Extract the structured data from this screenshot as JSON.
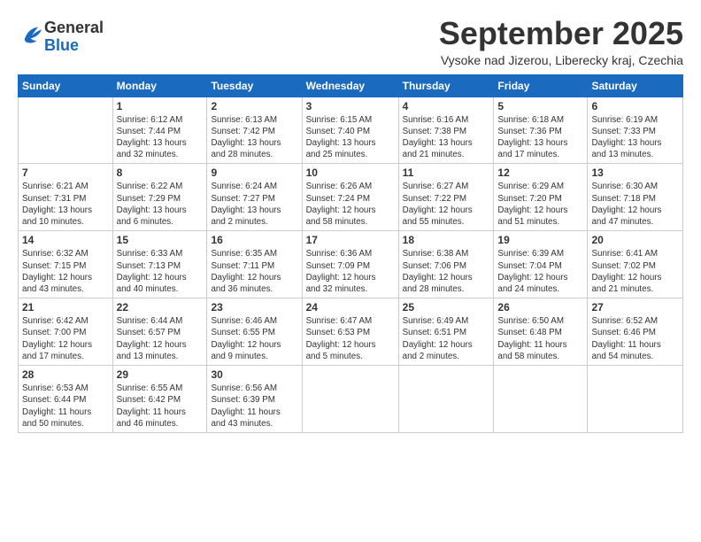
{
  "logo": {
    "general": "General",
    "blue": "Blue"
  },
  "title": "September 2025",
  "location": "Vysoke nad Jizerou, Liberecky kraj, Czechia",
  "days_header": [
    "Sunday",
    "Monday",
    "Tuesday",
    "Wednesday",
    "Thursday",
    "Friday",
    "Saturday"
  ],
  "weeks": [
    [
      {
        "day": "",
        "info": ""
      },
      {
        "day": "1",
        "info": "Sunrise: 6:12 AM\nSunset: 7:44 PM\nDaylight: 13 hours\nand 32 minutes."
      },
      {
        "day": "2",
        "info": "Sunrise: 6:13 AM\nSunset: 7:42 PM\nDaylight: 13 hours\nand 28 minutes."
      },
      {
        "day": "3",
        "info": "Sunrise: 6:15 AM\nSunset: 7:40 PM\nDaylight: 13 hours\nand 25 minutes."
      },
      {
        "day": "4",
        "info": "Sunrise: 6:16 AM\nSunset: 7:38 PM\nDaylight: 13 hours\nand 21 minutes."
      },
      {
        "day": "5",
        "info": "Sunrise: 6:18 AM\nSunset: 7:36 PM\nDaylight: 13 hours\nand 17 minutes."
      },
      {
        "day": "6",
        "info": "Sunrise: 6:19 AM\nSunset: 7:33 PM\nDaylight: 13 hours\nand 13 minutes."
      }
    ],
    [
      {
        "day": "7",
        "info": "Sunrise: 6:21 AM\nSunset: 7:31 PM\nDaylight: 13 hours\nand 10 minutes."
      },
      {
        "day": "8",
        "info": "Sunrise: 6:22 AM\nSunset: 7:29 PM\nDaylight: 13 hours\nand 6 minutes."
      },
      {
        "day": "9",
        "info": "Sunrise: 6:24 AM\nSunset: 7:27 PM\nDaylight: 13 hours\nand 2 minutes."
      },
      {
        "day": "10",
        "info": "Sunrise: 6:26 AM\nSunset: 7:24 PM\nDaylight: 12 hours\nand 58 minutes."
      },
      {
        "day": "11",
        "info": "Sunrise: 6:27 AM\nSunset: 7:22 PM\nDaylight: 12 hours\nand 55 minutes."
      },
      {
        "day": "12",
        "info": "Sunrise: 6:29 AM\nSunset: 7:20 PM\nDaylight: 12 hours\nand 51 minutes."
      },
      {
        "day": "13",
        "info": "Sunrise: 6:30 AM\nSunset: 7:18 PM\nDaylight: 12 hours\nand 47 minutes."
      }
    ],
    [
      {
        "day": "14",
        "info": "Sunrise: 6:32 AM\nSunset: 7:15 PM\nDaylight: 12 hours\nand 43 minutes."
      },
      {
        "day": "15",
        "info": "Sunrise: 6:33 AM\nSunset: 7:13 PM\nDaylight: 12 hours\nand 40 minutes."
      },
      {
        "day": "16",
        "info": "Sunrise: 6:35 AM\nSunset: 7:11 PM\nDaylight: 12 hours\nand 36 minutes."
      },
      {
        "day": "17",
        "info": "Sunrise: 6:36 AM\nSunset: 7:09 PM\nDaylight: 12 hours\nand 32 minutes."
      },
      {
        "day": "18",
        "info": "Sunrise: 6:38 AM\nSunset: 7:06 PM\nDaylight: 12 hours\nand 28 minutes."
      },
      {
        "day": "19",
        "info": "Sunrise: 6:39 AM\nSunset: 7:04 PM\nDaylight: 12 hours\nand 24 minutes."
      },
      {
        "day": "20",
        "info": "Sunrise: 6:41 AM\nSunset: 7:02 PM\nDaylight: 12 hours\nand 21 minutes."
      }
    ],
    [
      {
        "day": "21",
        "info": "Sunrise: 6:42 AM\nSunset: 7:00 PM\nDaylight: 12 hours\nand 17 minutes."
      },
      {
        "day": "22",
        "info": "Sunrise: 6:44 AM\nSunset: 6:57 PM\nDaylight: 12 hours\nand 13 minutes."
      },
      {
        "day": "23",
        "info": "Sunrise: 6:46 AM\nSunset: 6:55 PM\nDaylight: 12 hours\nand 9 minutes."
      },
      {
        "day": "24",
        "info": "Sunrise: 6:47 AM\nSunset: 6:53 PM\nDaylight: 12 hours\nand 5 minutes."
      },
      {
        "day": "25",
        "info": "Sunrise: 6:49 AM\nSunset: 6:51 PM\nDaylight: 12 hours\nand 2 minutes."
      },
      {
        "day": "26",
        "info": "Sunrise: 6:50 AM\nSunset: 6:48 PM\nDaylight: 11 hours\nand 58 minutes."
      },
      {
        "day": "27",
        "info": "Sunrise: 6:52 AM\nSunset: 6:46 PM\nDaylight: 11 hours\nand 54 minutes."
      }
    ],
    [
      {
        "day": "28",
        "info": "Sunrise: 6:53 AM\nSunset: 6:44 PM\nDaylight: 11 hours\nand 50 minutes."
      },
      {
        "day": "29",
        "info": "Sunrise: 6:55 AM\nSunset: 6:42 PM\nDaylight: 11 hours\nand 46 minutes."
      },
      {
        "day": "30",
        "info": "Sunrise: 6:56 AM\nSunset: 6:39 PM\nDaylight: 11 hours\nand 43 minutes."
      },
      {
        "day": "",
        "info": ""
      },
      {
        "day": "",
        "info": ""
      },
      {
        "day": "",
        "info": ""
      },
      {
        "day": "",
        "info": ""
      }
    ]
  ]
}
